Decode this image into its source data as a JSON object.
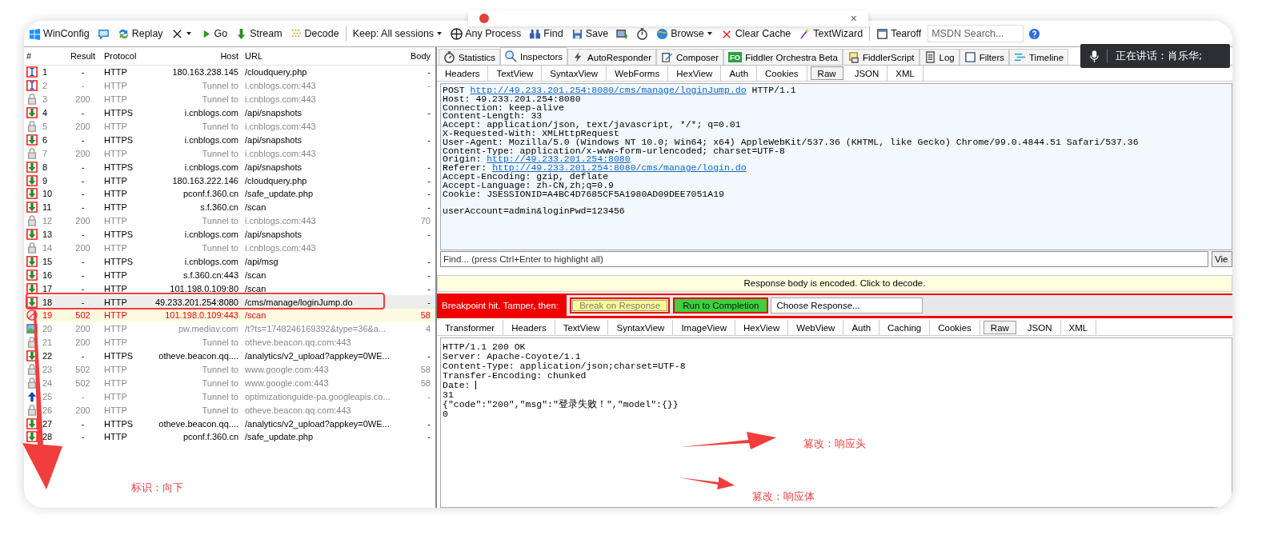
{
  "notification": {
    "close": "×"
  },
  "toolbar": {
    "items": [
      {
        "kind": "windows",
        "label": "WinConfig"
      },
      {
        "kind": "comment"
      },
      {
        "kind": "replay",
        "label": "Replay"
      },
      {
        "kind": "remove",
        "caret": true
      },
      {
        "kind": "go",
        "label": "Go"
      },
      {
        "kind": "stream",
        "label": "Stream"
      },
      {
        "kind": "decode",
        "label": "Decode",
        "sep_after": true
      },
      {
        "kind": "keep",
        "label": "Keep: All sessions",
        "caret": true
      },
      {
        "kind": "process",
        "label": "Any Process"
      },
      {
        "kind": "find",
        "label": "Find"
      },
      {
        "kind": "save",
        "label": "Save"
      },
      {
        "kind": "camera"
      },
      {
        "kind": "timer"
      },
      {
        "kind": "browse",
        "label": "Browse",
        "caret": true
      },
      {
        "kind": "clear",
        "label": "Clear Cache"
      },
      {
        "kind": "textwizard",
        "label": "TextWizard",
        "sep_after": true
      },
      {
        "kind": "tearoff",
        "label": "Tearoff"
      }
    ],
    "search": {
      "placeholder": "MSDN Search..."
    }
  },
  "sessions": {
    "columns": [
      "#",
      "Result",
      "Protocol",
      "Host",
      "URL",
      "Body"
    ],
    "rows": [
      {
        "num": "1",
        "result": "-",
        "protocol": "HTTP",
        "host": "180.163.238.145",
        "url": "/cloudquery.php",
        "body": "-",
        "kind": "paused-request",
        "greyed": false,
        "error": false,
        "selected": false
      },
      {
        "num": "2",
        "result": "-",
        "protocol": "HTTP",
        "host": "Tunnel to",
        "url": "i.cnblogs.com:443",
        "body": "-",
        "kind": "paused-request",
        "greyed": true,
        "error": false,
        "selected": false
      },
      {
        "num": "3",
        "result": "200",
        "protocol": "HTTP",
        "host": "Tunnel to",
        "url": "i.cnblogs.com:443",
        "kind": "lock",
        "greyed": true,
        "error": false,
        "selected": false
      },
      {
        "num": "4",
        "result": "-",
        "protocol": "HTTPS",
        "host": "i.cnblogs.com",
        "url": "/api/snapshots",
        "body": "-",
        "kind": "paused-response",
        "greyed": false,
        "error": false,
        "selected": false
      },
      {
        "num": "5",
        "result": "200",
        "protocol": "HTTP",
        "host": "Tunnel to",
        "url": "i.cnblogs.com:443",
        "kind": "lock",
        "greyed": true,
        "error": false,
        "selected": false
      },
      {
        "num": "6",
        "result": "-",
        "protocol": "HTTPS",
        "host": "i.cnblogs.com",
        "url": "/api/snapshots",
        "body": "-",
        "kind": "paused-response",
        "greyed": false,
        "error": false,
        "selected": false
      },
      {
        "num": "7",
        "result": "200",
        "protocol": "HTTP",
        "host": "Tunnel to",
        "url": "i.cnblogs.com:443",
        "kind": "lock",
        "greyed": true,
        "error": false,
        "selected": false
      },
      {
        "num": "8",
        "result": "-",
        "protocol": "HTTPS",
        "host": "i.cnblogs.com",
        "url": "/api/snapshots",
        "body": "-",
        "kind": "paused-response",
        "greyed": false,
        "error": false,
        "selected": false
      },
      {
        "num": "9",
        "result": "-",
        "protocol": "HTTP",
        "host": "180.163.222.146",
        "url": "/cloudquery.php",
        "body": "-",
        "kind": "paused-response",
        "greyed": false,
        "error": false,
        "selected": false
      },
      {
        "num": "10",
        "result": "-",
        "protocol": "HTTP",
        "host": "pconf.f.360.cn",
        "url": "/safe_update.php",
        "body": "-",
        "kind": "paused-response",
        "greyed": false,
        "error": false,
        "selected": false
      },
      {
        "num": "11",
        "result": "-",
        "protocol": "HTTP",
        "host": "s.f.360.cn",
        "url": "/scan",
        "body": "-",
        "kind": "paused-response",
        "greyed": false,
        "error": false,
        "selected": false
      },
      {
        "num": "12",
        "result": "200",
        "protocol": "HTTP",
        "host": "Tunnel to",
        "url": "i.cnblogs.com:443",
        "body": "70",
        "kind": "lock",
        "greyed": true,
        "error": false,
        "selected": false
      },
      {
        "num": "13",
        "result": "-",
        "protocol": "HTTPS",
        "host": "i.cnblogs.com",
        "url": "/api/snapshots",
        "body": "-",
        "kind": "paused-response",
        "greyed": false,
        "error": false,
        "selected": false
      },
      {
        "num": "14",
        "result": "200",
        "protocol": "HTTP",
        "host": "Tunnel to",
        "url": "i.cnblogs.com:443",
        "kind": "lock",
        "greyed": true,
        "error": false,
        "selected": false
      },
      {
        "num": "15",
        "result": "-",
        "protocol": "HTTPS",
        "host": "i.cnblogs.com",
        "url": "/api/msg",
        "body": "-",
        "kind": "paused-response",
        "greyed": false,
        "error": false,
        "selected": false
      },
      {
        "num": "16",
        "result": "-",
        "protocol": "HTTP",
        "host": "s.f.360.cn:443",
        "url": "/scan",
        "body": "-",
        "kind": "paused-response",
        "greyed": false,
        "error": false,
        "selected": false
      },
      {
        "num": "17",
        "result": "-",
        "protocol": "HTTP",
        "host": "101.198.0.109:80",
        "url": "/scan",
        "body": "-",
        "kind": "paused-response",
        "greyed": false,
        "error": false,
        "selected": false
      },
      {
        "num": "18",
        "result": "-",
        "protocol": "HTTP",
        "host": "49.233.201.254:8080",
        "url": "/cms/manage/loginJump.do",
        "body": "-",
        "kind": "paused-response",
        "greyed": false,
        "error": false,
        "selected": true
      },
      {
        "num": "19",
        "result": "502",
        "protocol": "HTTP",
        "host": "101.198.0.109:443",
        "url": "/scan",
        "body": "58",
        "kind": "blocked",
        "error": true,
        "selected": false
      },
      {
        "num": "20",
        "result": "200",
        "protocol": "HTTP",
        "host": "pw.mediav.com",
        "url": "/t?ts=1748246169392&type=36&a...",
        "body": "4",
        "kind": "image",
        "greyed": true,
        "error": false,
        "selected": false
      },
      {
        "num": "21",
        "result": "200",
        "protocol": "HTTP",
        "host": "Tunnel to",
        "url": "otheve.beacon.qq.com:443",
        "kind": "lock",
        "greyed": true,
        "error": false,
        "selected": false
      },
      {
        "num": "22",
        "result": "-",
        "protocol": "HTTPS",
        "host": "otheve.beacon.qq....",
        "url": "/analytics/v2_upload?appkey=0WE...",
        "body": "-",
        "kind": "paused-response",
        "greyed": false,
        "error": false,
        "selected": false
      },
      {
        "num": "23",
        "result": "502",
        "protocol": "HTTP",
        "host": "Tunnel to",
        "url": "www.google.com:443",
        "body": "58",
        "kind": "lock",
        "greyed": true,
        "error": false,
        "selected": false
      },
      {
        "num": "24",
        "result": "502",
        "protocol": "HTTP",
        "host": "Tunnel to",
        "url": "www.google.com:443",
        "body": "58",
        "kind": "lock",
        "greyed": true,
        "error": false,
        "selected": false
      },
      {
        "num": "25",
        "result": "-",
        "protocol": "HTTP",
        "host": "Tunnel to",
        "url": "optimizationguide-pa.googleapis.co...",
        "body": "-",
        "kind": "upload",
        "greyed": true,
        "error": false,
        "selected": false
      },
      {
        "num": "26",
        "result": "200",
        "protocol": "HTTP",
        "host": "Tunnel to",
        "url": "otheve.beacon.qq.com:443",
        "kind": "lock",
        "greyed": true,
        "error": false,
        "selected": false
      },
      {
        "num": "27",
        "result": "-",
        "protocol": "HTTPS",
        "host": "otheve.beacon.qq....",
        "url": "/analytics/v2_upload?appkey=0WE...",
        "body": "-",
        "kind": "paused-response",
        "greyed": false,
        "error": false,
        "selected": false
      },
      {
        "num": "28",
        "result": "-",
        "protocol": "HTTP",
        "host": "pconf.f.360.cn",
        "url": "/safe_update.php",
        "body": "-",
        "kind": "paused-response",
        "greyed": false,
        "error": false,
        "selected": false
      }
    ]
  },
  "main_tabs": [
    {
      "kind": "statistics",
      "label": "Statistics",
      "selected": false
    },
    {
      "kind": "inspectors",
      "label": "Inspectors",
      "selected": true
    },
    {
      "kind": "autoresponder",
      "label": "AutoResponder",
      "selected": false
    },
    {
      "kind": "composer",
      "label": "Composer",
      "selected": false
    },
    {
      "kind": "orchestra",
      "badge": "FO",
      "label": "Fiddler Orchestra Beta",
      "selected": false
    },
    {
      "kind": "script",
      "label": "FiddlerScript",
      "selected": false
    },
    {
      "kind": "log",
      "label": "Log",
      "selected": false
    },
    {
      "kind": "filters",
      "label": "Filters",
      "selected": false
    },
    {
      "kind": "timeline",
      "label": "Timeline",
      "selected": false
    }
  ],
  "speaking": {
    "text": "正在讲话：肖乐华;"
  },
  "request": {
    "tabs": [
      {
        "label": "Headers",
        "selected": false
      },
      {
        "label": "TextView",
        "selected": false
      },
      {
        "label": "SyntaxView",
        "selected": false
      },
      {
        "label": "WebForms",
        "selected": false
      },
      {
        "label": "HexView",
        "selected": false
      },
      {
        "label": "Auth",
        "selected": false
      },
      {
        "label": "Cookies",
        "selected": false
      },
      {
        "label": "Raw",
        "selected": true
      },
      {
        "label": "JSON",
        "selected": false
      },
      {
        "label": "XML",
        "selected": false
      }
    ],
    "headers": [
      {
        "parts": [
          {
            "text": "POST "
          },
          {
            "text": "http://49.233.201.254:8080/cms/manage/loginJump.do",
            "link": true
          },
          {
            "text": " HTTP/1.1"
          }
        ]
      },
      {
        "parts": [
          {
            "text": "Host: 49.233.201.254:8080"
          }
        ]
      },
      {
        "parts": [
          {
            "text": "Connection: keep-alive"
          }
        ]
      },
      {
        "parts": [
          {
            "text": "Content-Length: 33"
          }
        ]
      },
      {
        "parts": [
          {
            "text": "Accept: application/json, text/javascript, */*; q=0.01"
          }
        ]
      },
      {
        "parts": [
          {
            "text": "X-Requested-With: XMLHttpRequest"
          }
        ]
      },
      {
        "parts": [
          {
            "text": "User-Agent: Mozilla/5.0 (Windows NT 10.0; Win64; x64) AppleWebKit/537.36 (KHTML, like Gecko) Chrome/99.0.4844.51 Safari/537.36"
          }
        ]
      },
      {
        "parts": [
          {
            "text": "Content-Type: application/x-www-form-urlencoded; charset=UTF-8"
          }
        ]
      },
      {
        "parts": [
          {
            "text": "Origin: "
          },
          {
            "text": "http://49.233.201.254:8080",
            "link": true
          }
        ]
      },
      {
        "parts": [
          {
            "text": "Referer: "
          },
          {
            "text": "http://49.233.201.254:8080/cms/manage/login.do",
            "link": true
          }
        ]
      },
      {
        "parts": [
          {
            "text": "Accept-Encoding: gzip, deflate"
          }
        ]
      },
      {
        "parts": [
          {
            "text": "Accept-Language: zh-CN,zh;q=0.9"
          }
        ]
      },
      {
        "parts": [
          {
            "text": "Cookie: JSESSIONID=A4BC4D7685CF5A1980AD09DEE7051A19"
          }
        ]
      }
    ],
    "body": [
      "userAccount=admin&loginPwd=123456"
    ],
    "find": {
      "placeholder": "Find... (press Ctrl+Enter to highlight all)",
      "button": "Vie"
    }
  },
  "notice": "Response body is encoded. Click to decode.",
  "breakpoint": {
    "label": "Breakpoint hit. Tamper, then:",
    "break_button": "Break on Response",
    "run_button": "Run to Completion",
    "choose": "Choose Response..."
  },
  "response": {
    "tabs": [
      {
        "label": "Transformer",
        "selected": false
      },
      {
        "label": "Headers",
        "selected": false
      },
      {
        "label": "TextView",
        "selected": false
      },
      {
        "label": "SyntaxView",
        "selected": false
      },
      {
        "label": "ImageView",
        "selected": false
      },
      {
        "label": "HexView",
        "selected": false
      },
      {
        "label": "WebView",
        "selected": false
      },
      {
        "label": "Auth",
        "selected": false
      },
      {
        "label": "Caching",
        "selected": false
      },
      {
        "label": "Cookies",
        "selected": false
      },
      {
        "label": "Raw",
        "selected": true
      },
      {
        "label": "JSON",
        "selected": false
      },
      {
        "label": "XML",
        "selected": false
      }
    ],
    "lines": [
      {
        "text": "HTTP/1.1 200 OK"
      },
      {
        "text": "Server: Apache-Coyote/1.1"
      },
      {
        "text": "Content-Type: application/json;charset=UTF-8"
      },
      {
        "text": "Transfer-Encoding: chunked"
      },
      {
        "text": "Date:",
        "cursor": true
      },
      {
        "text": "31"
      },
      {
        "text": "{\"code\":\"200\",\"msg\":\"登录失败！\",\"model\":{}}"
      },
      {
        "text": "0"
      }
    ]
  },
  "annotations": [
    "标识：向下",
    "篡改：响应头",
    "篡改：响应体"
  ]
}
